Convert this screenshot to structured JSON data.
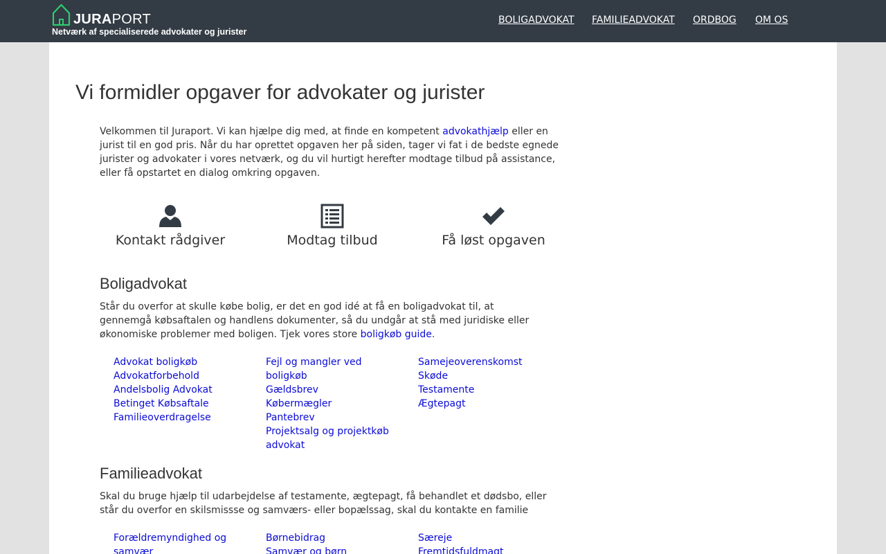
{
  "header": {
    "logo_bold": "JURA",
    "logo_light": "PORT",
    "tagline": "Netværk af specialiserede advokater og jurister",
    "nav": [
      "BOLIGADVOKAT",
      "FAMILIEADVOKAT",
      "ORDBOG",
      "OM OS"
    ]
  },
  "main": {
    "title": "Vi formidler opgaver for advokater og jurister",
    "intro_before": "Velkommen til Juraport. Vi kan hjælpe dig med, at finde en kompetent ",
    "intro_link": "advokathjælp",
    "intro_after": " eller en jurist til en god pris. Når du har oprettet opgaven her på siden, tager vi fat i de bedste egnede jurister og advokater i vores netværk, og du vil hurtigt herefter modtage tilbud på assistance, eller få opstartet en dialog omkring opgaven.",
    "steps": [
      {
        "label": "Kontakt rådgiver",
        "icon": "user-icon"
      },
      {
        "label": "Modtag tilbud",
        "icon": "list-icon"
      },
      {
        "label": "Få løst opgaven",
        "icon": "checkmark-icon"
      }
    ],
    "sections": [
      {
        "heading": "Boligadvokat",
        "text_before": "Står du overfor at skulle købe bolig, er det en god idé at få en boligadvokat til, at gennemgå købsaftalen og handlens dokumenter, så du undgår at stå med juridiske eller økonomiske problemer med boligen. Tjek vores store ",
        "text_link": "boligkøb guide",
        "text_after": ".",
        "columns": [
          [
            "Advokat boligkøb",
            "Advokatforbehold",
            "Andelsbolig Advokat",
            "Betinget Købsaftale",
            "Familieoverdragelse"
          ],
          [
            "Fejl og mangler ved boligkøb",
            "Gældsbrev",
            "Købermægler",
            "Pantebrev",
            "Projektsalg og projektkøb advokat"
          ],
          [
            "Samejeoverenskomst",
            "Skøde",
            "Testamente",
            "Ægtepagt"
          ]
        ]
      },
      {
        "heading": "Familieadvokat",
        "text_before": "Skal du bruge hjælp til udarbejdelse af testamente, ægtepagt, få behandlet et dødsbo, eller står du overfor en skilsmissse og samværs- eller bopælssag, skal du kontakte en familie",
        "text_link": "",
        "text_after": "",
        "columns": [
          [
            "Forældremyndighed og samvær"
          ],
          [
            "Børnebidrag",
            "Samvær og børn"
          ],
          [
            "Særeje",
            "Fremtidsfuldmagt"
          ]
        ]
      }
    ]
  },
  "colors": {
    "header_bg": "#333b44",
    "logo_green": "#2ecc71",
    "link": "#0b0bd6",
    "page_bg": "#e2e2e2"
  }
}
